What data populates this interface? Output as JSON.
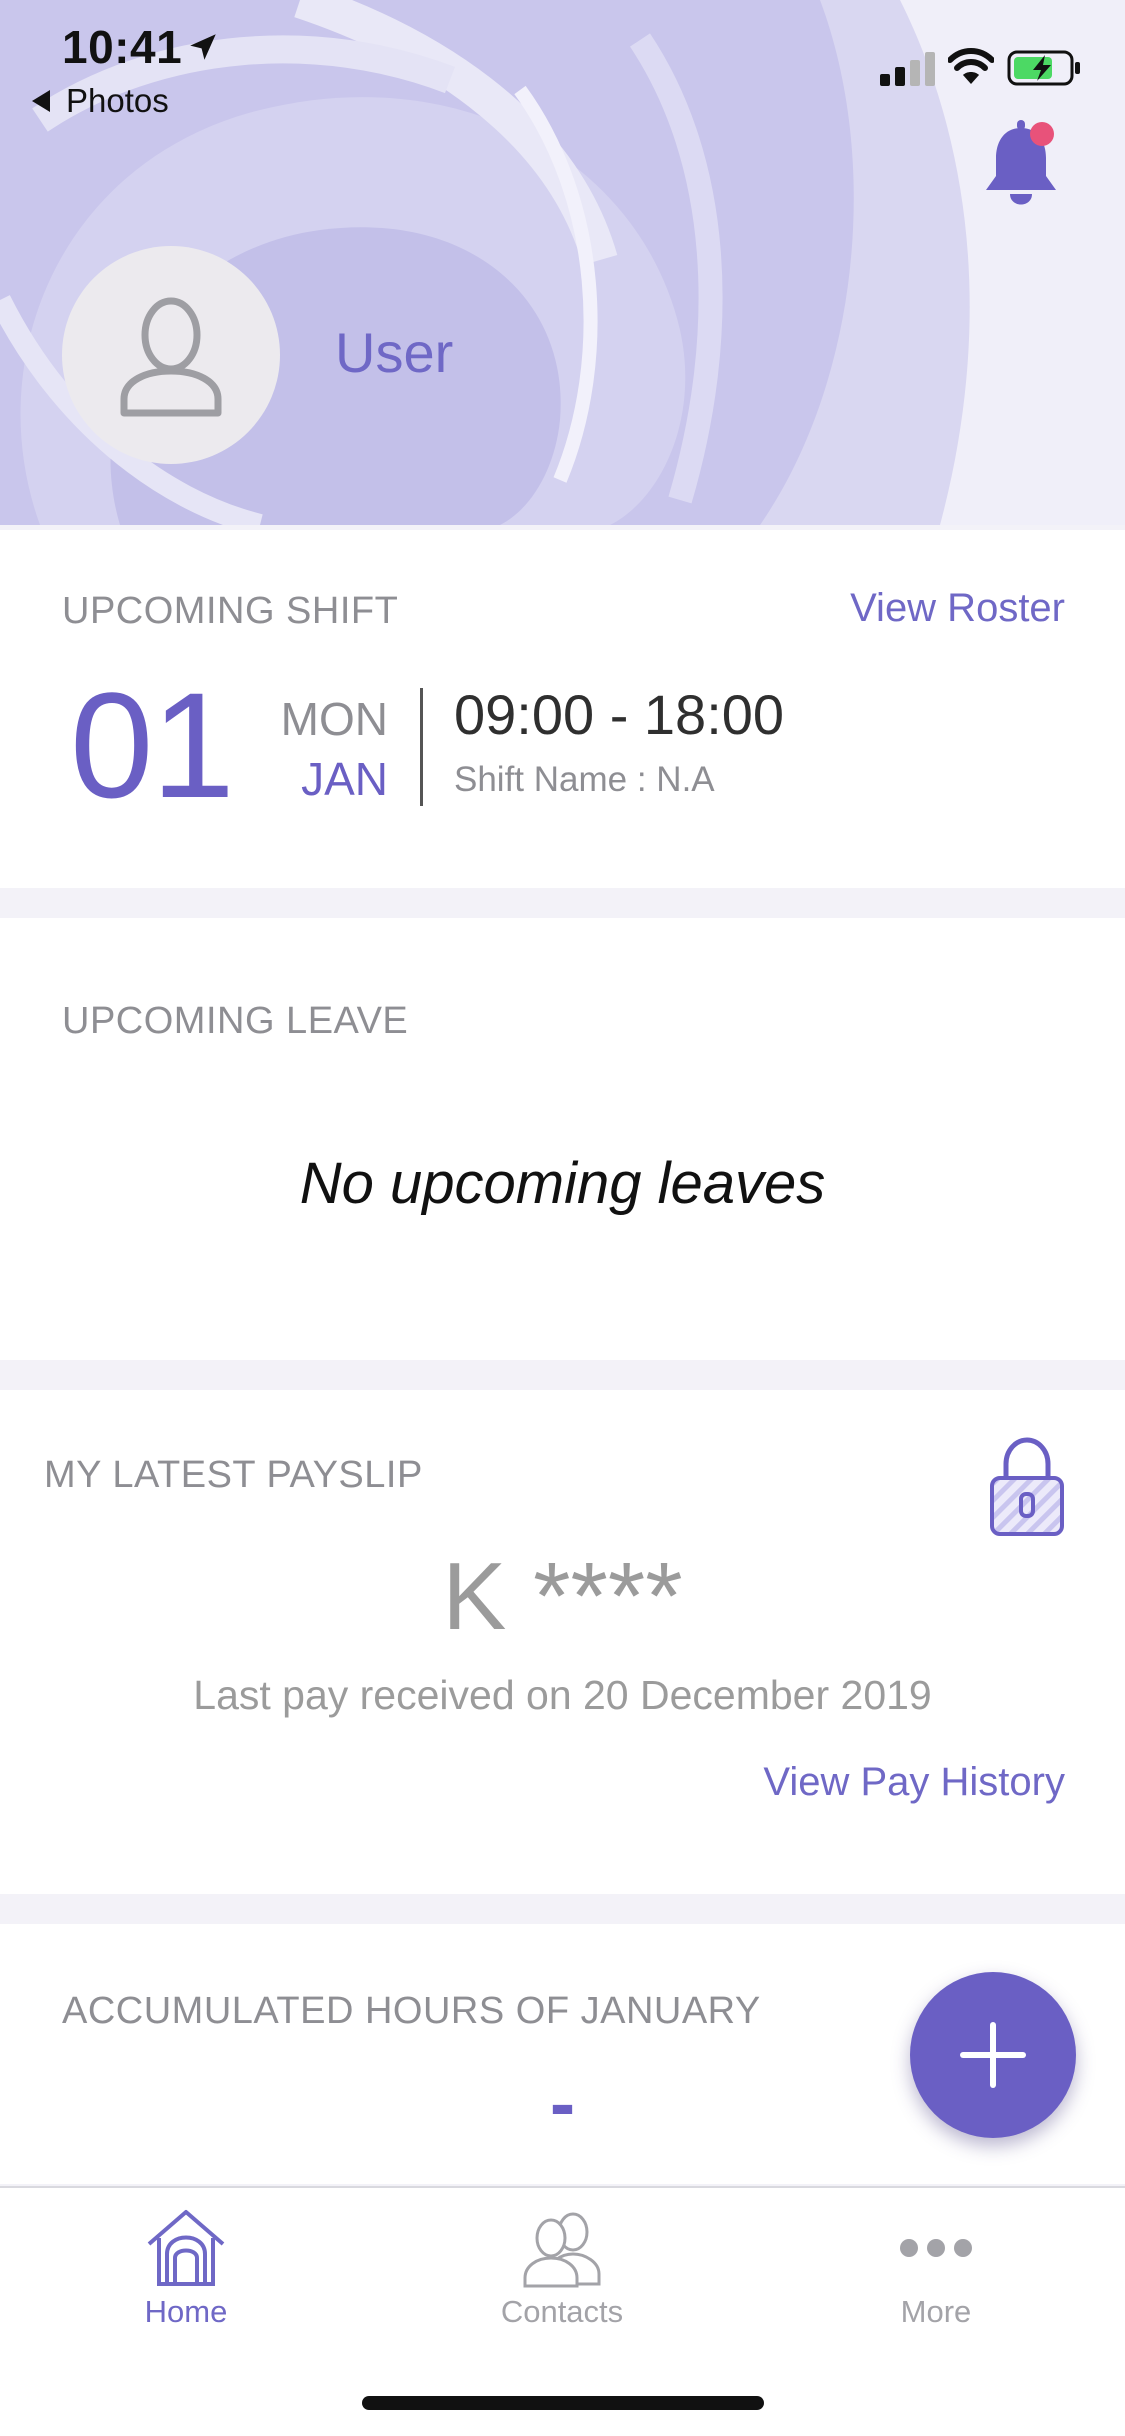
{
  "status_bar": {
    "time": "10:41",
    "back_app": "Photos"
  },
  "header": {
    "user_name": "User"
  },
  "upcoming_shift": {
    "title": "UPCOMING SHIFT",
    "view_roster_label": "View Roster",
    "day": "01",
    "weekday": "MON",
    "month": "JAN",
    "time_range": "09:00 - 18:00",
    "shift_name": "Shift Name : N.A"
  },
  "upcoming_leave": {
    "title": "UPCOMING LEAVE",
    "empty_message": "No upcoming leaves"
  },
  "payslip": {
    "title": "MY LATEST PAYSLIP",
    "amount": "K ****",
    "last_pay_note": "Last pay received on 20 December 2019",
    "view_history_label": "View Pay History"
  },
  "accumulated_hours": {
    "title": "ACCUMULATED HOURS OF JANUARY",
    "value": "-"
  },
  "tabbar": {
    "items": [
      {
        "label": "Home",
        "icon": "home-icon",
        "active": true
      },
      {
        "label": "Contacts",
        "icon": "contacts-icon",
        "active": false
      },
      {
        "label": "More",
        "icon": "more-icon",
        "active": false
      }
    ]
  },
  "colors": {
    "accent": "#6a5fc4",
    "accent_light": "#6f68c6",
    "notification_dot": "#e8527a",
    "battery_fill": "#4cd964"
  }
}
